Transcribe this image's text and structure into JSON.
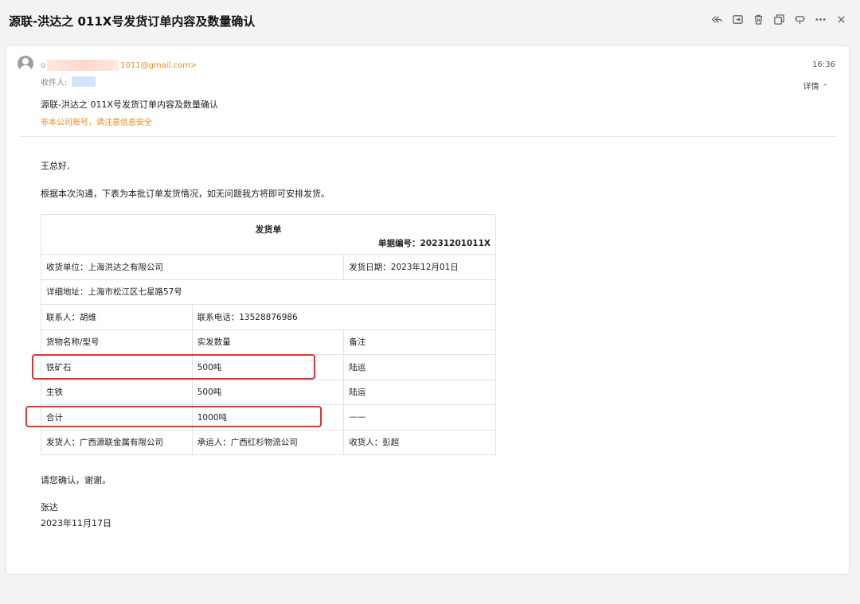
{
  "window": {
    "title": "源联-洪达之 011X号发货订单内容及数量确认",
    "toolbar": [
      {
        "name": "reply-all-icon"
      },
      {
        "name": "move-folder-icon"
      },
      {
        "name": "delete-icon"
      },
      {
        "name": "new-window-icon"
      },
      {
        "name": "pin-icon"
      },
      {
        "name": "more-icon"
      },
      {
        "name": "close-icon"
      }
    ]
  },
  "email": {
    "sender_prefix": "o",
    "sender_email": "1011@gmail.com>",
    "time": "16:36",
    "recipient_label": "收件人:",
    "details_label": "详情",
    "subject": "源联-洪达之 011X号发货订单内容及数量确认",
    "warning": "非本公司账号，请注意信息安全",
    "greeting": "王总好,",
    "intro": "根据本次沟通，下表为本批订单发货情况，如无问题我方将即可安排发货。",
    "closing": "请您确认，谢谢。",
    "signature_name": "张达",
    "signature_date": "2023年11月17日"
  },
  "invoice": {
    "title": "发货单",
    "doc_no": "单据编号：20231201011X",
    "consignee": "收货单位：上海洪达之有限公司",
    "ship_date": "发货日期：2023年12月01日",
    "address": "详细地址：上海市松江区七星路57号",
    "contact": "联系人：胡维",
    "phone": "联系电话：13528876986",
    "headers": [
      "货物名称/型号",
      "实发数量",
      "备注"
    ],
    "rows": [
      [
        "铁矿石",
        "500吨",
        "陆运"
      ],
      [
        "生铁",
        "500吨",
        "陆运"
      ],
      [
        "合计",
        "1000吨",
        "——"
      ]
    ],
    "shipper": "发货人：广西源联金属有限公司",
    "carrier": "承运人：广西红杉物流公司",
    "receiver": "收货人：彭超"
  },
  "annotations": {
    "highlight_color": "#e0323a"
  }
}
